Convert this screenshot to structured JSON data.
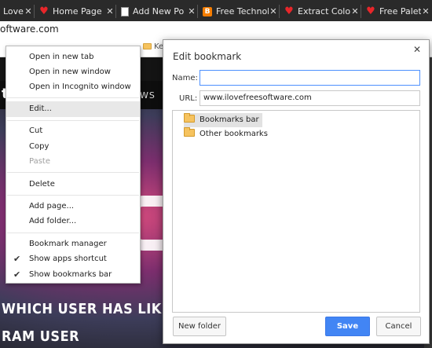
{
  "tabs": [
    {
      "title": "Love",
      "favicon": "",
      "icon_name": "none"
    },
    {
      "title": "Home Page",
      "favicon": "♥",
      "icon_name": "heart-favicon-icon"
    },
    {
      "title": "Add New Po",
      "favicon": "",
      "icon_name": "document-favicon-icon"
    },
    {
      "title": "Free Technol",
      "favicon": "B",
      "icon_name": "blogger-favicon-icon"
    },
    {
      "title": "Extract Colo",
      "favicon": "♥",
      "icon_name": "heart-favicon-icon"
    },
    {
      "title": "Free Palette",
      "favicon": "♥",
      "icon_name": "heart-favicon-icon"
    }
  ],
  "tab_close_glyph": "✕",
  "address_bar": {
    "url": "oftware.com"
  },
  "bookmarks_bar": {
    "partial_items": [
      "Keywords S"
    ]
  },
  "page": {
    "nav_letter": "t",
    "nav_link": "WS",
    "headline_line1": "WHICH USER HAS LIKED MO",
    "headline_line2": "RAM USER"
  },
  "context_menu": {
    "items": [
      {
        "label": "Open in new tab",
        "state": "normal",
        "checked": false
      },
      {
        "label": "Open in new window",
        "state": "normal",
        "checked": false
      },
      {
        "label": "Open in Incognito window",
        "state": "normal",
        "checked": false
      },
      {
        "label": "Edit...",
        "state": "highlighted",
        "checked": false
      },
      {
        "label": "Cut",
        "state": "normal",
        "checked": false
      },
      {
        "label": "Copy",
        "state": "normal",
        "checked": false
      },
      {
        "label": "Paste",
        "state": "disabled",
        "checked": false
      },
      {
        "label": "Delete",
        "state": "normal",
        "checked": false
      },
      {
        "label": "Add page...",
        "state": "normal",
        "checked": false
      },
      {
        "label": "Add folder...",
        "state": "normal",
        "checked": false
      },
      {
        "label": "Bookmark manager",
        "state": "normal",
        "checked": false
      },
      {
        "label": "Show apps shortcut",
        "state": "normal",
        "checked": true
      },
      {
        "label": "Show bookmarks bar",
        "state": "normal",
        "checked": true
      }
    ],
    "check_glyph": "✔"
  },
  "edit_bookmark_dialog": {
    "title": "Edit bookmark",
    "close_glyph": "✕",
    "name_label": "Name:",
    "name_value": "",
    "url_label": "URL:",
    "url_value": "www.ilovefreesoftware.com",
    "folders": [
      {
        "label": "Bookmarks bar",
        "selected": true
      },
      {
        "label": "Other bookmarks",
        "selected": false
      }
    ],
    "new_folder_button": "New folder",
    "save_button": "Save",
    "cancel_button": "Cancel"
  },
  "colors": {
    "accent": "#4285f4",
    "tab_strip": "#2a2a2a",
    "heart": "#e8262a",
    "folder": "#f6c35f"
  }
}
